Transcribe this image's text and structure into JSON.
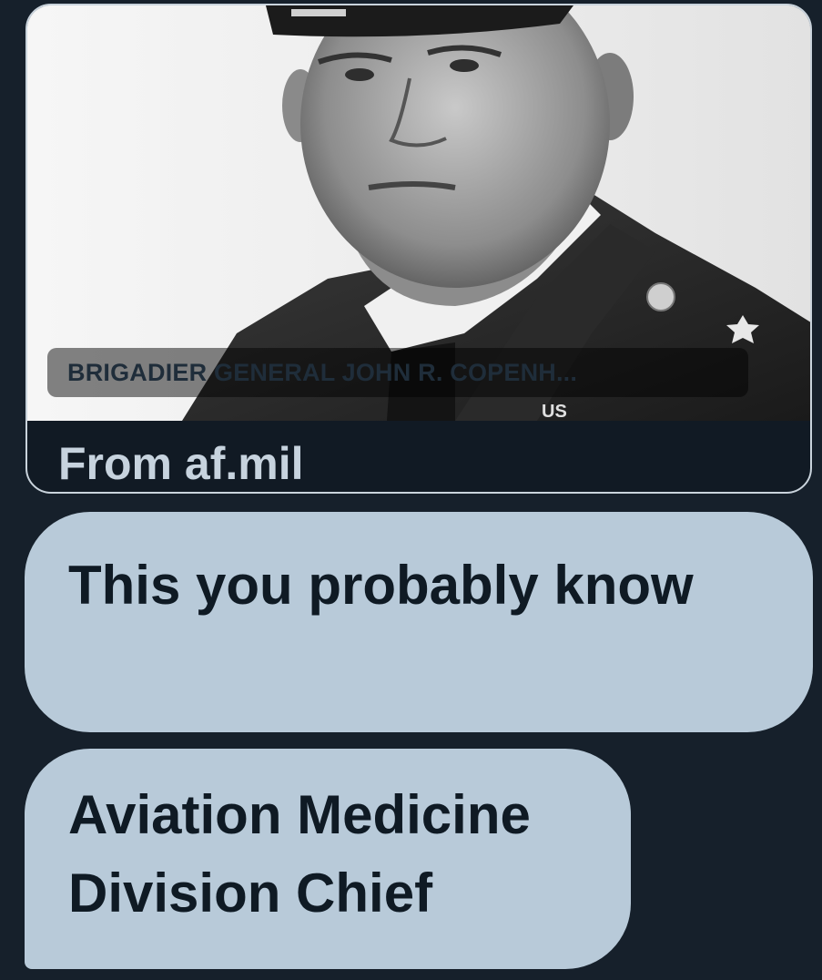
{
  "link_card": {
    "image_caption": "BRIGADIER GENERAL JOHN R. COPENH...",
    "source": "From af.mil"
  },
  "messages": [
    {
      "lines": [
        "This you probably know"
      ]
    },
    {
      "lines": [
        "Aviation Medicine",
        "Division Chief"
      ]
    }
  ],
  "colors": {
    "background": "#16202b",
    "bubble": "#b8cad9",
    "bubble_text": "#0f1a24",
    "card_border": "#c9d3dc",
    "source_text": "#c7d3de"
  }
}
